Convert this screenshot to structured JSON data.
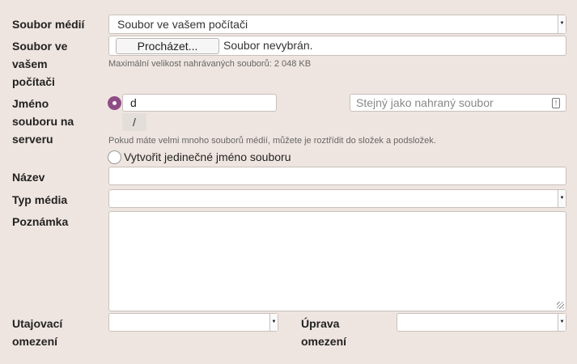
{
  "labels": {
    "media_source": "Soubor médií",
    "local_file_1": "Soubor ve",
    "local_file_2": "vašem",
    "local_file_3": "počítači",
    "server_name_1": "Jméno",
    "server_name_2": "souboru na",
    "server_name_3": "serveru",
    "title": "Název",
    "media_type": "Typ média",
    "note": "Poznámka",
    "confidentiality_1": "Utajovací",
    "confidentiality_2": "omezení",
    "editing_1": "Úprava",
    "editing_2": "omezení"
  },
  "media_source_select": {
    "value": "Soubor ve vašem počítači"
  },
  "file_upload": {
    "browse_label": "Procházet...",
    "status": "Soubor nevybrán.",
    "max_size_hint": "Maximální velikost nahrávaných souborů: 2 048 KB"
  },
  "server_name": {
    "folder_value": "d",
    "separator": "/",
    "filename_placeholder": "Stejný jako nahraný soubor",
    "folders_hint": "Pokud máte velmi mnoho souborů médií, můžete je roztřídit do složek a podsložek.",
    "unique_option_label": "Vytvořit jedinečné jméno souboru"
  },
  "title_field": {
    "value": ""
  },
  "media_type_select": {
    "value": ""
  },
  "note_field": {
    "value": ""
  },
  "confidentiality_select": {
    "value": ""
  },
  "editing_select": {
    "value": ""
  },
  "colors": {
    "accent": "#8e4d86",
    "background": "#efe5e0",
    "border": "#c9c0bc"
  },
  "icons": [
    "dropdown-arrow-icon",
    "radio-icon",
    "resize-handle-icon",
    "placeholder-info-icon"
  ]
}
